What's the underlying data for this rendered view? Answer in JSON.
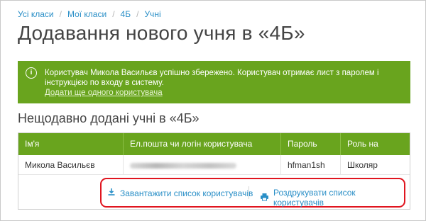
{
  "breadcrumb": {
    "items": [
      "Усі класи",
      "Мої класи",
      "4Б",
      "Учні"
    ],
    "separator": "/"
  },
  "page_title": "Додавання нового учня в «4Б»",
  "alert": {
    "icon": "info-icon",
    "message": "Користувач Микола Васильєв успішно збережено. Користувач отримає лист з паролем і інструкцією по входу в систему.",
    "link": "Додати ще одного користувача",
    "color": "#69a41e"
  },
  "recent": {
    "title": "Нещодавно додані учні в «4Б»",
    "columns": [
      "Ім'я",
      "Ел.пошта чи логін користувача",
      "Пароль",
      "Роль на порталі"
    ],
    "rows": [
      {
        "name": "Микола Васильєв",
        "login": "",
        "password": "hfman1sh",
        "role": "Школяр"
      }
    ]
  },
  "actions": {
    "download_label": "Завантажити список користувачів",
    "download_icon": "download-icon",
    "print_label": "Роздрукувати список користувачів",
    "print_icon": "printer-icon",
    "highlight_color": "#e0151f"
  },
  "colors": {
    "accent_green": "#69a41e",
    "link_blue": "#2a8fc7"
  }
}
